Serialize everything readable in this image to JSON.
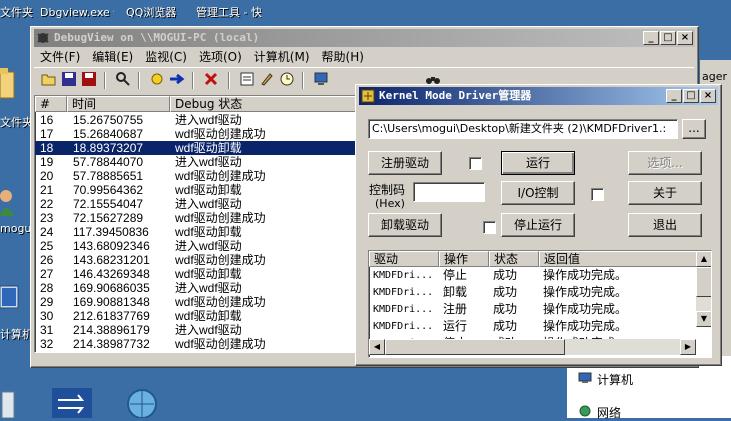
{
  "desktop": {
    "top_labels": [
      "文件夹",
      "Dbgview.exe 快捷方式",
      "QQ浏览器",
      "管理工具 - 快捷方式"
    ],
    "left_labels": [
      "文件夹",
      "mogui",
      "计算机"
    ],
    "right_items": [
      "计算机",
      "网络"
    ],
    "manager_fragment": "ager"
  },
  "debugview": {
    "title": "DebugView on \\\\MOGUI-PC (local)",
    "menu": [
      "文件(F)",
      "编辑(E)",
      "监视(C)",
      "选项(O)",
      "计算机(M)",
      "帮助(H)"
    ],
    "columns": [
      "#",
      "时间",
      "Debug 状态"
    ],
    "rows": [
      {
        "n": "16",
        "t": "15.26750755",
        "msg": "进入wdf驱动"
      },
      {
        "n": "17",
        "t": "15.26840687",
        "msg": "wdf驱动创建成功"
      },
      {
        "n": "18",
        "t": "18.89373207",
        "msg": "wdf驱动卸载"
      },
      {
        "n": "19",
        "t": "57.78844070",
        "msg": "进入wdf驱动"
      },
      {
        "n": "20",
        "t": "57.78885651",
        "msg": "wdf驱动创建成功"
      },
      {
        "n": "21",
        "t": "70.99564362",
        "msg": "wdf驱动卸载"
      },
      {
        "n": "22",
        "t": "72.15554047",
        "msg": "进入wdf驱动"
      },
      {
        "n": "23",
        "t": "72.15627289",
        "msg": "wdf驱动创建成功"
      },
      {
        "n": "24",
        "t": "117.39450836",
        "msg": "wdf驱动卸载"
      },
      {
        "n": "25",
        "t": "143.68092346",
        "msg": "进入wdf驱动"
      },
      {
        "n": "26",
        "t": "143.68231201",
        "msg": "wdf驱动创建成功"
      },
      {
        "n": "27",
        "t": "146.43269348",
        "msg": "wdf驱动卸载"
      },
      {
        "n": "28",
        "t": "169.90686035",
        "msg": "进入wdf驱动"
      },
      {
        "n": "29",
        "t": "169.90881348",
        "msg": "wdf驱动创建成功"
      },
      {
        "n": "30",
        "t": "212.61837769",
        "msg": "wdf驱动卸载"
      },
      {
        "n": "31",
        "t": "214.38896179",
        "msg": "进入wdf驱动"
      },
      {
        "n": "32",
        "t": "214.38987732",
        "msg": "wdf驱动创建成功"
      }
    ],
    "selected_index": 2
  },
  "kmd": {
    "title": "Kernel Mode Driver管理器",
    "path": "C:\\Users\\mogui\\Desktop\\新建文件夹 (2)\\KMDFDriver1.:",
    "browse": "...",
    "register": "注册驱动",
    "run": "运行",
    "ctrl_code_label": "控制码",
    "hex_label": "(Hex)",
    "ioctl": "I/O控制",
    "unload": "卸载驱动",
    "stop": "停止运行",
    "options": "选项...",
    "about": "关于",
    "exit": "退出",
    "columns": [
      "驱动",
      "操作",
      "状态",
      "返回值"
    ],
    "rows": [
      {
        "drv": "KMDFDri...",
        "op": "停止",
        "st": "成功",
        "ret": "操作成功完成。"
      },
      {
        "drv": "KMDFDri...",
        "op": "卸载",
        "st": "成功",
        "ret": "操作成功完成。"
      },
      {
        "drv": "KMDFDri...",
        "op": "注册",
        "st": "成功",
        "ret": "操作成功完成。"
      },
      {
        "drv": "KMDFDri...",
        "op": "运行",
        "st": "成功",
        "ret": "操作成功完成。"
      },
      {
        "drv": "KMDFDri...",
        "op": "停止",
        "st": "成功",
        "ret": "操作成功完成。"
      }
    ]
  },
  "colors": {
    "desktop": "#3a6ea5",
    "title_active": "#0a246a",
    "selection": "#0a246a",
    "face": "#d4d0c8"
  }
}
